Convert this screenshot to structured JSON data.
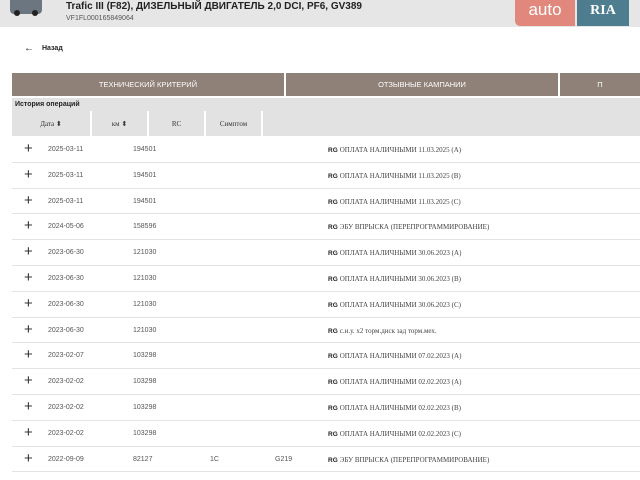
{
  "header": {
    "title": "Trafic III (F82), ДИЗЕЛЬНЫЙ ДВИГАТЕЛЬ 2,0 DCI, PF6, GV389",
    "vin": "VF1FL000165849064",
    "logo_auto": "auto",
    "logo_ria": "RIA"
  },
  "back_label": "Назад",
  "tabs": [
    "ТЕХНИЧЕСКИЙ КРИТЕРИЙ",
    "ОТЗЫВНЫЕ КАМПАНИИ",
    "П"
  ],
  "section_title": "История операций",
  "columns": [
    "Дата ⬍",
    "км ⬍",
    "RC",
    "Симптом",
    ""
  ],
  "colors": {
    "tab_bg": "#8f8177",
    "header_bg": "#e6e6e6",
    "logo_auto": "#e2877c",
    "logo_ria": "#4e7d90"
  },
  "rows": [
    {
      "date": "2025-03-11",
      "km": "194501",
      "rc": "",
      "symptom": "",
      "brand": "RG",
      "desc": "ОПЛАТА НАЛИЧНЫМИ 11.03.2025 (A)"
    },
    {
      "date": "2025-03-11",
      "km": "194501",
      "rc": "",
      "symptom": "",
      "brand": "RG",
      "desc": "ОПЛАТА НАЛИЧНЫМИ 11.03.2025 (B)"
    },
    {
      "date": "2025-03-11",
      "km": "194501",
      "rc": "",
      "symptom": "",
      "brand": "RG",
      "desc": "ОПЛАТА НАЛИЧНЫМИ 11.03.2025 (C)"
    },
    {
      "date": "2024-05-06",
      "km": "158596",
      "rc": "",
      "symptom": "",
      "brand": "RG",
      "desc": "ЭБУ ВПРЫСКА (ПЕРЕПРОГРАММИРОВАНИЕ)"
    },
    {
      "date": "2023-06-30",
      "km": "121030",
      "rc": "",
      "symptom": "",
      "brand": "RG",
      "desc": "ОПЛАТА НАЛИЧНЫМИ 30.06.2023 (A)"
    },
    {
      "date": "2023-06-30",
      "km": "121030",
      "rc": "",
      "symptom": "",
      "brand": "RG",
      "desc": "ОПЛАТА НАЛИЧНЫМИ 30.06.2023 (B)"
    },
    {
      "date": "2023-06-30",
      "km": "121030",
      "rc": "",
      "symptom": "",
      "brand": "RG",
      "desc": "ОПЛАТА НАЛИЧНЫМИ 30.06.2023 (C)"
    },
    {
      "date": "2023-06-30",
      "km": "121030",
      "rc": "",
      "symptom": "",
      "brand": "RG",
      "desc": "с.и.у. x2 торм.диск зад торм.мех."
    },
    {
      "date": "2023-02-07",
      "km": "103298",
      "rc": "",
      "symptom": "",
      "brand": "RG",
      "desc": "ОПЛАТА НАЛИЧНЫМИ 07.02.2023 (A)"
    },
    {
      "date": "2023-02-02",
      "km": "103298",
      "rc": "",
      "symptom": "",
      "brand": "RG",
      "desc": "ОПЛАТА НАЛИЧНЫМИ 02.02.2023 (A)"
    },
    {
      "date": "2023-02-02",
      "km": "103298",
      "rc": "",
      "symptom": "",
      "brand": "RG",
      "desc": "ОПЛАТА НАЛИЧНЫМИ 02.02.2023 (B)"
    },
    {
      "date": "2023-02-02",
      "km": "103298",
      "rc": "",
      "symptom": "",
      "brand": "RG",
      "desc": "ОПЛАТА НАЛИЧНЫМИ 02.02.2023 (C)"
    },
    {
      "date": "2022-09-09",
      "km": "82127",
      "rc": "1C",
      "symptom": "G219",
      "brand": "RG",
      "desc": "ЭБУ ВПРЫСКА (ПЕРЕПРОГРАММИРОВАНИЕ)"
    }
  ]
}
